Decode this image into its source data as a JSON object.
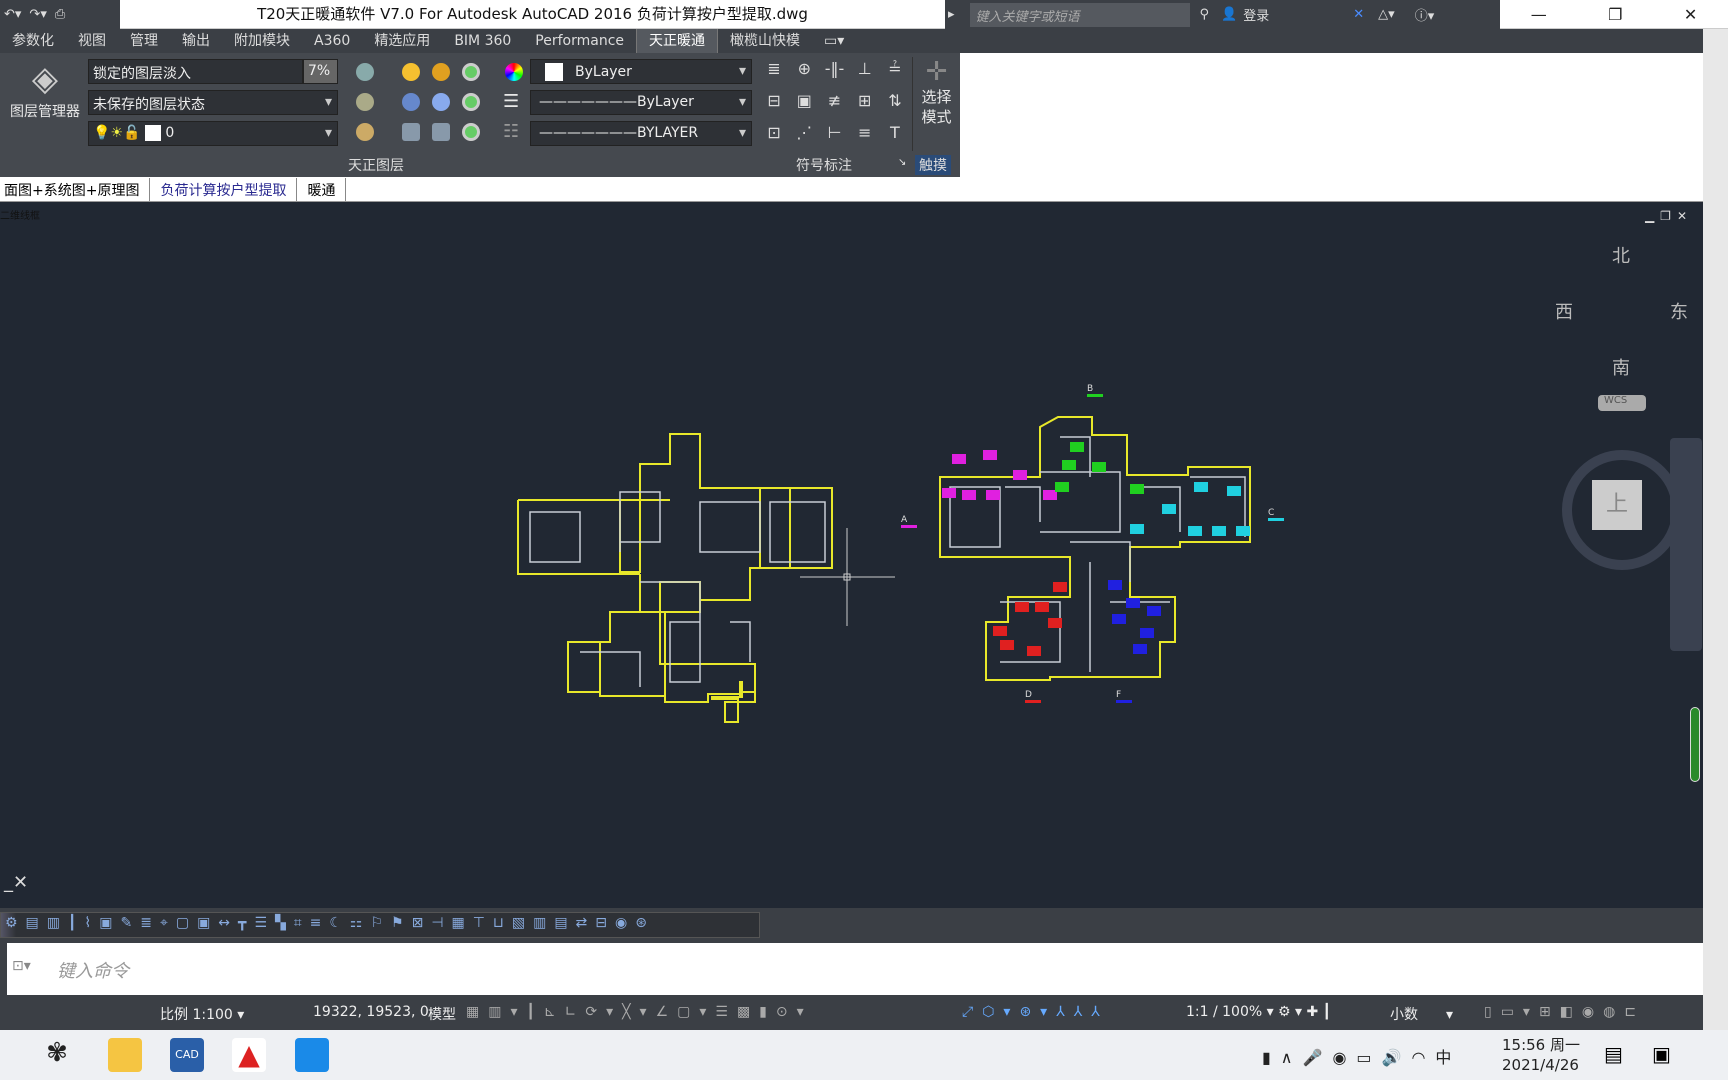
{
  "titlebar": {
    "title": "T20天正暖通软件 V7.0 For Autodesk AutoCAD 2016    负荷计算按户型提取.dwg",
    "search_placeholder": "键入关键字或短语",
    "login": "登录"
  },
  "menu_tabs": [
    "参数化",
    "视图",
    "管理",
    "输出",
    "附加模块",
    "A360",
    "精选应用",
    "BIM 360",
    "Performance",
    "天正暖通",
    "橄榄山快模"
  ],
  "active_tab": "天正暖通",
  "ribbon": {
    "layer_manager": "图层管理器",
    "layer_fade": "锁定的图层淡入",
    "fade_pct": "7%",
    "layer_state": "未保存的图层状态",
    "current_layer": "0",
    "color": "ByLayer",
    "linetype": "ByLayer",
    "lineweight": "BYLAYER",
    "panel_layers": "天正图层",
    "panel_symbols": "符号标注",
    "select_mode": "选择\n模式",
    "panel_touch": "触摸"
  },
  "file_tabs": [
    "面图+系统图+原理图",
    "负荷计算按户型提取",
    "暖通"
  ],
  "active_file": "负荷计算按户型提取",
  "viewport_label": "二维线框",
  "viewcube": {
    "north": "北",
    "south": "南",
    "east": "东",
    "west": "西",
    "top": "上",
    "wcs": "WCS"
  },
  "axis_labels": [
    "A",
    "B",
    "C",
    "D",
    "F"
  ],
  "command": {
    "placeholder": "键入命令"
  },
  "status": {
    "scale": "比例 1:100",
    "coords": "19322, 19523, 0",
    "model": "模型",
    "anno_scale": "1:1 / 100%",
    "units": "小数"
  },
  "taskbar": {
    "time": "15:56 周一",
    "date": "2021/4/26",
    "ime": "中"
  },
  "colors": {
    "canvas": "#212833",
    "plan_wall": "#e8e82a",
    "room_magenta": "#e020e0",
    "room_green": "#20d020",
    "room_cyan": "#20d0e0",
    "room_red": "#e02020",
    "room_blue": "#2020e0"
  }
}
